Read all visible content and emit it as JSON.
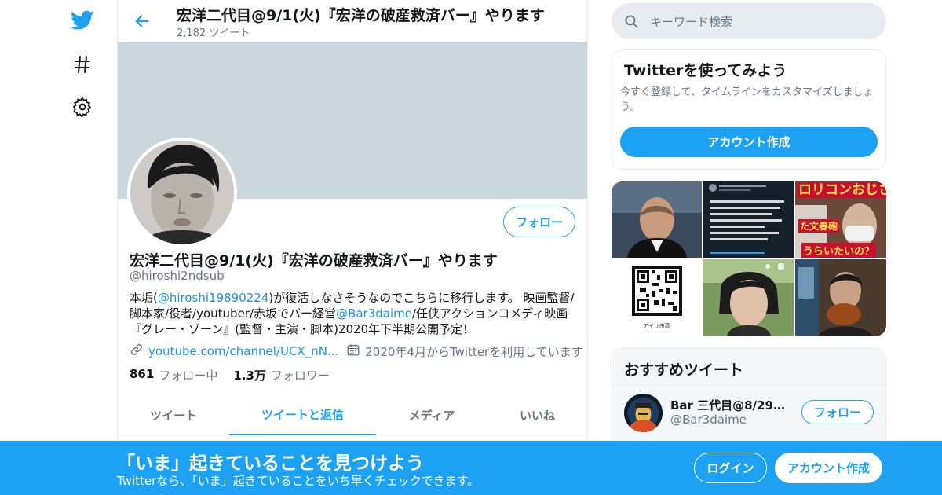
{
  "colors": {
    "accent": "#1da1f2",
    "link": "#1b95e0",
    "muted": "#657786",
    "text": "#14171a",
    "banner": "#ccd6dd"
  },
  "nav": {
    "icons": [
      "twitter-logo-icon",
      "hashtag-icon",
      "gear-icon"
    ]
  },
  "header": {
    "title": "宏洋二代目@9/1(火)『宏洋の破産救済バー』やります",
    "tweet_count": "2,182 ツイート"
  },
  "profile": {
    "name": "宏洋二代目@9/1(火)『宏洋の破産救済バー』やります",
    "handle": "@hiroshi2ndsub",
    "follow_label": "フォロー",
    "bio": {
      "part1": "本垢(",
      "mention1": "@hiroshi19890224",
      "part2": ")が復活しなさそうなのでこちらに移行します。 映画監督/脚本家/役者/youtuber/赤坂でバー経営",
      "mention2": "@Bar3daime",
      "part3": "/任侠アクションコメディ映画『グレー・ゾーン』(監督・主演・脚本)2020年下半期公開予定！"
    },
    "website": "youtube.com/channel/UCX_nN...",
    "joined": "2020年4月からTwitterを利用しています",
    "following_count": "861",
    "following_label": "フォロー中",
    "followers_count": "1.3万",
    "followers_label": "フォロワー"
  },
  "tabs": [
    {
      "label": "ツイート",
      "active": false
    },
    {
      "label": "ツイートと返信",
      "active": true
    },
    {
      "label": "メディア",
      "active": false
    },
    {
      "label": "いいね",
      "active": false
    }
  ],
  "sidebar": {
    "search_placeholder": "キーワード検索",
    "try_card": {
      "title": "Twitterを使ってみよう",
      "description": "今すぐ登録して、タイムラインをカスタマイズしましょう。",
      "button": "アカウント作成"
    },
    "media": {
      "tile3_text1": "ロリコンおじさ",
      "tile3_text2": "た文春砲",
      "tile3_text3": "うらいたいの？",
      "tile4_caption": "アイリ由高"
    },
    "recommended": {
      "title": "おすすめツイート",
      "name": "Bar 三代目@8/29み…",
      "handle": "@Bar3daime",
      "follow_label": "フォロー"
    }
  },
  "bottom_bar": {
    "title": "「いま」起きていることを見つけよう",
    "subtitle": "Twitterなら、「いま」起きていることをいち早くチェックできます。",
    "login": "ログイン",
    "signup": "アカウント作成"
  }
}
